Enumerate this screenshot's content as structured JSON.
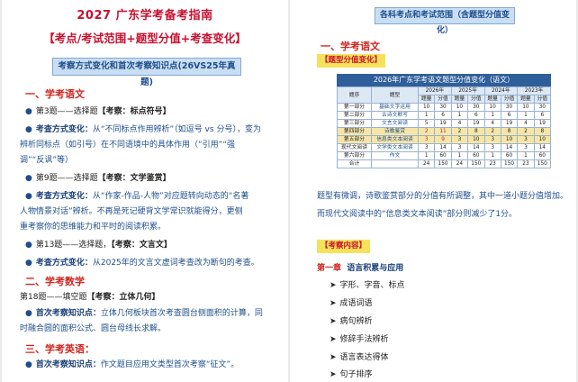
{
  "left": {
    "title": "2027 广东学考备考指南",
    "subtitle": "【考点/考试范围+题型分值+考查变化】",
    "banner": "考察方式变化和首次考察知识点(26VS25年真题)",
    "chinese": {
      "heading": "一、学考语文",
      "q3": {
        "label": "第3题——选择题",
        "tag": "【考察：标点符号】"
      },
      "q3_change": {
        "key": "考查方式变化：",
        "line1": "从“不同标点作用辨析”（如逗号 vs 分号），变为",
        "line2": "辨析同标点（如引号）在不同语境中的具体作用（“引用”“强",
        "line3": "调”“反讽”等）"
      },
      "q9": {
        "label": "第9题——选择题",
        "tag": "【考察：文学鉴赏】"
      },
      "q9_change": {
        "key": "考查方式变化：",
        "line1": "从“作家-作品-人物”对应题转向动态的“名著",
        "line2": "人物情景对话”辨析。不再是死记硬背文学常识就能得分，更侧",
        "line3": "重考察你的思维能力和平时的阅读积累。"
      },
      "q13": {
        "label": "第13题——选择题，",
        "tag": "【考察：文言文】"
      },
      "q13_change": {
        "key": "考查方式变化：",
        "line1": "从2025年的文言文虚词考查改为断句的考查。"
      }
    },
    "math": {
      "heading": "二、学考数学",
      "q18": {
        "label": "第18题——填空题",
        "tag": "【考察：立体几何】"
      },
      "first": {
        "key": "首次考察知识点：",
        "line1": "立体几何板块首次考查圆台侧面积的计算，同",
        "line2": "时融合圆的面积公式、圆台母线长求解。"
      }
    },
    "english": {
      "heading": "三、学考英语：",
      "first": {
        "key": "首次考察知识点：",
        "line1": "作文题目应用文类型首次考察“征文”。"
      }
    }
  },
  "right": {
    "banner": "各科考点和考试范围（含题型分值变化）",
    "heading": "一、学考语文",
    "tag1": "【题型分值变化】",
    "table": {
      "title": "2026年广东学考语文题型分值变化（语文）",
      "col_part": "题序",
      "col_type": "题型",
      "years": [
        "2026年",
        "2025年",
        "2024年",
        "2023年"
      ],
      "sub": [
        "题量",
        "分值"
      ],
      "rows": [
        {
          "part": "第一部分",
          "type": "基础文字运用",
          "vals": [
            "10",
            "30",
            "10",
            "30",
            "10",
            "30",
            "10",
            "30"
          ],
          "hl": false
        },
        {
          "part": "第二部分",
          "type": "古诗文默写",
          "vals": [
            "1",
            "6",
            "1",
            "6",
            "1",
            "6",
            "1",
            "6"
          ],
          "hl": false
        },
        {
          "part": "第三部分",
          "type": "文言文阅读",
          "vals": [
            "5",
            "19",
            "4",
            "19",
            "4",
            "19",
            "4",
            "19"
          ],
          "hl": false
        },
        {
          "part": "第四部分",
          "type": "诗歌鉴赏",
          "vals": [
            "2",
            "11",
            "2",
            "8",
            "2",
            "8",
            "2",
            "8"
          ],
          "hl": true
        },
        {
          "part": "第五部分",
          "type": "信息类文本阅读",
          "vals": [
            "3",
            "9",
            "3",
            "10",
            "3",
            "10",
            "3",
            "10"
          ],
          "hl": true
        },
        {
          "part": "现代文阅读",
          "type": "文学类文本阅读",
          "vals": [
            "3",
            "14",
            "3",
            "14",
            "3",
            "14",
            "3",
            "14"
          ],
          "hl": false
        },
        {
          "part": "第六部分",
          "type": "作文",
          "vals": [
            "1",
            "60",
            "1",
            "60",
            "1",
            "60",
            "1",
            "60"
          ],
          "hl": false
        },
        {
          "part": "合计",
          "type": "",
          "vals": [
            "24",
            "150",
            "24",
            "150",
            "23",
            "150",
            "23",
            "150"
          ],
          "hl": false
        }
      ]
    },
    "para1": "题型有微调，诗歌鉴赏部分的分值有所调整，其中一道小题分值增加。",
    "para2": "而现代文阅读中的“信息类文本阅读”部分则减少了1分。",
    "tag2": "【考察内容】",
    "chapter_no": "第一章",
    "chapter_title": "语言积累与应用",
    "items": [
      "字形、字音、标点",
      "成语词语",
      "病句辨析",
      "修辞手法辨析",
      "语言表达得体",
      "句子排序"
    ]
  }
}
